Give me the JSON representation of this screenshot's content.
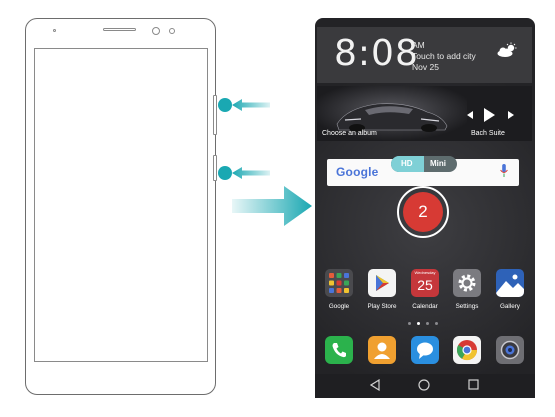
{
  "status": {
    "time": "8:08",
    "ampm": "AM",
    "city_prompt": "Touch to add city",
    "date": "Nov 25",
    "weather_icon": "sun-cloud-icon"
  },
  "media": {
    "choose_album": "Choose an album",
    "track": "Bach Suite"
  },
  "search": {
    "logo": "Google",
    "toggle_hd": "HD",
    "toggle_mini": "Mini"
  },
  "badge_number": "2",
  "apps": [
    {
      "label": "Google",
      "icon": "google-folder-icon"
    },
    {
      "label": "Play Store",
      "icon": "play-store-icon"
    },
    {
      "label": "Calendar",
      "icon": "calendar-icon",
      "day_name": "Wednesday",
      "day_number": "25"
    },
    {
      "label": "Settings",
      "icon": "gear-icon"
    },
    {
      "label": "Gallery",
      "icon": "gallery-icon"
    }
  ],
  "dock": [
    {
      "icon": "phone-icon"
    },
    {
      "icon": "contacts-icon"
    },
    {
      "icon": "messages-icon"
    },
    {
      "icon": "chrome-icon"
    },
    {
      "icon": "camera-icon"
    }
  ],
  "colors": {
    "accent_teal": "#1aa8b2",
    "badge_red": "#d73a34"
  }
}
